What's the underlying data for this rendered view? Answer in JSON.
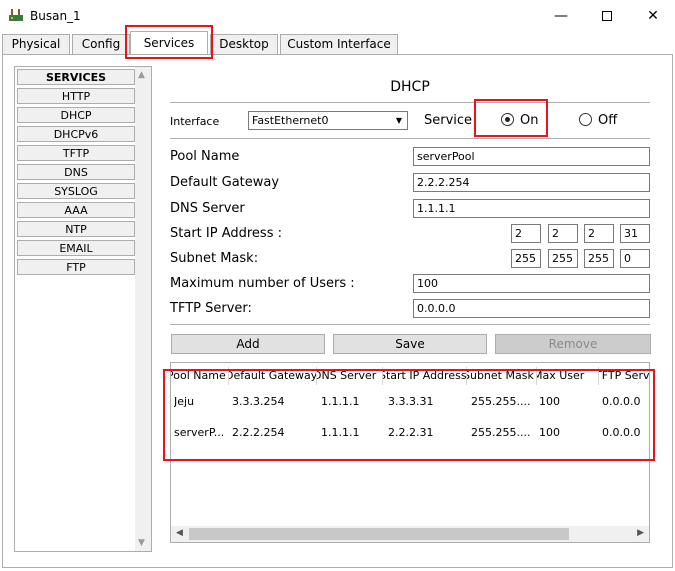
{
  "window": {
    "title": "Busan_1",
    "minimize": "—",
    "close": "✕"
  },
  "tabs": [
    {
      "label": "Physical"
    },
    {
      "label": "Config"
    },
    {
      "label": "Services",
      "active": true
    },
    {
      "label": "Desktop"
    },
    {
      "label": "Custom Interface"
    }
  ],
  "services": {
    "header": "SERVICES",
    "items": [
      "HTTP",
      "DHCP",
      "DHCPv6",
      "TFTP",
      "DNS",
      "SYSLOG",
      "AAA",
      "NTP",
      "EMAIL",
      "FTP"
    ]
  },
  "dhcp": {
    "title": "DHCP",
    "interface_label": "Interface",
    "interface_value": "FastEthernet0",
    "service_label": "Service",
    "on_label": "On",
    "off_label": "Off",
    "service_state": "On",
    "fields": {
      "pool_name_label": "Pool Name",
      "pool_name_value": "serverPool",
      "gateway_label": "Default Gateway",
      "gateway_value": "2.2.2.254",
      "dns_label": "DNS Server",
      "dns_value": "1.1.1.1",
      "start_ip_label": "Start IP Address :",
      "start_ip": [
        "2",
        "2",
        "2",
        "31"
      ],
      "subnet_label": "Subnet Mask:",
      "subnet": [
        "255",
        "255",
        "255",
        "0"
      ],
      "max_users_label": "Maximum number of Users :",
      "max_users_value": "100",
      "tftp_label": "TFTP Server:",
      "tftp_value": "0.0.0.0"
    },
    "buttons": {
      "add": "Add",
      "save": "Save",
      "remove": "Remove"
    },
    "table": {
      "columns": [
        "Pool Name",
        "Default Gateway",
        "DNS Server",
        "Start IP Address",
        "Subnet Mask",
        "Max User",
        "TFTP Server"
      ],
      "rows": [
        [
          "Jeju",
          "3.3.3.254",
          "1.1.1.1",
          "3.3.3.31",
          "255.255....",
          "100",
          "0.0.0.0"
        ],
        [
          "serverP...",
          "2.2.2.254",
          "1.1.1.1",
          "2.2.2.31",
          "255.255....",
          "100",
          "0.0.0.0"
        ]
      ]
    }
  },
  "colors": {
    "highlight": "#e8141c",
    "panel_bg": "#f0f0f0",
    "border": "#adadad"
  }
}
